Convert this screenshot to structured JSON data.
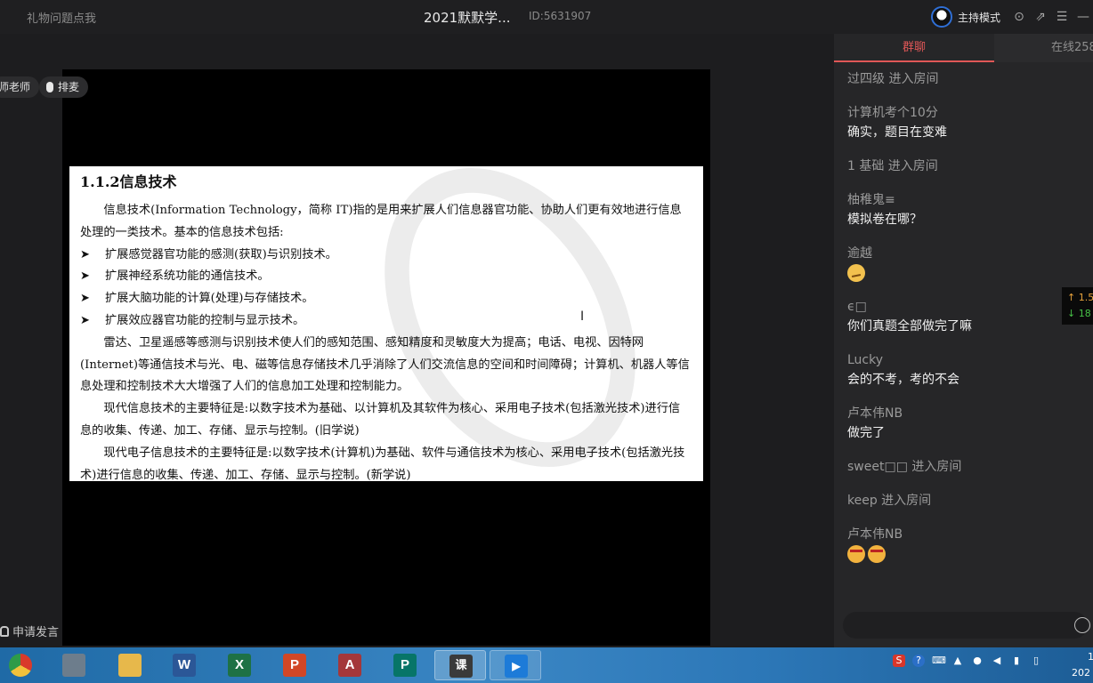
{
  "topbar": {
    "gift_link": "礼物问题点我",
    "room_title": "2021默默学...",
    "room_id": "ID:5631907",
    "host_mode": "主持模式",
    "icons": [
      "settings-icon",
      "popout-icon",
      "menu-icon",
      "minimize-icon"
    ]
  },
  "stage": {
    "teacher_label": "师老师",
    "queue_button": "排麦",
    "apply_speak": "申请发言",
    "document": {
      "heading": "1.1.2信息技术",
      "intro": "信息技术(Information Technology，简称 IT)指的是用来扩展人们信息器官功能、协助人们更有效地进行信息处理的一类技术。基本的信息技术包括:",
      "bullets": [
        "扩展感觉器官功能的感测(获取)与识别技术。",
        "扩展神经系统功能的通信技术。",
        "扩展大脑功能的计算(处理)与存储技术。",
        "扩展效应器官功能的控制与显示技术。"
      ],
      "bullet_marker": "➤",
      "para1": "雷达、卫星遥感等感测与识别技术使人们的感知范围、感知精度和灵敏度大为提高；电话、电视、因特网(Internet)等通信技术与光、电、磁等信息存储技术几乎消除了人们交流信息的空间和时间障碍；计算机、机器人等信息处理和控制技术大大增强了人们的信息加工处理和控制能力。",
      "para2": "现代信息技术的主要特征是:以数字技术为基础、以计算机及其软件为核心、采用电子技术(包括激光技术)进行信息的收集、传递、加工、存储、显示与控制。(旧学说)",
      "para3": "现代电子信息技术的主要特征是:以数字技术(计算机)为基础、软件与通信技术为核心、采用电子技术(包括激光技术)进行信息的收集、传递、加工、存储、显示与控制。(新学说)"
    }
  },
  "chat": {
    "tab_group": "群聊",
    "tab_online": "在线258",
    "messages": [
      {
        "name": "过四级 进入房间",
        "text": ""
      },
      {
        "name": "计算机考个10分",
        "text": "确实，题目在变难"
      },
      {
        "name": "1 基础 进入房间",
        "text": ""
      },
      {
        "name": "柚稚鬼≡",
        "text": "模拟卷在哪？"
      },
      {
        "name": "逾越",
        "text": ""
      },
      {
        "name": "ϵ□",
        "text": "你们真题全部做完了嘛"
      },
      {
        "name": "Lucky",
        "text": "会的不考，考的不会"
      },
      {
        "name": "卢本伟NB",
        "text": "做完了"
      },
      {
        "name": "sweet□□ 进入房间",
        "text": ""
      },
      {
        "name": "keep 进入房间",
        "text": ""
      },
      {
        "name": "卢本伟NB",
        "text": ""
      }
    ],
    "speed_up": "↑ 1.5",
    "speed_down": "↓ 18"
  },
  "taskbar": {
    "apps": [
      {
        "name": "chrome-app",
        "glyph": "",
        "color": "#d93a2b"
      },
      {
        "name": "calculator-app",
        "glyph": "",
        "color": "#6d7d8c"
      },
      {
        "name": "file-explorer-app",
        "glyph": "",
        "color": "#e7b84b"
      },
      {
        "name": "word-app",
        "glyph": "W",
        "color": "#2b5797"
      },
      {
        "name": "excel-app",
        "glyph": "X",
        "color": "#1e7145"
      },
      {
        "name": "powerpoint-app",
        "glyph": "P",
        "color": "#d24726"
      },
      {
        "name": "access-app",
        "glyph": "A",
        "color": "#a4373a"
      },
      {
        "name": "publisher-app",
        "glyph": "P",
        "color": "#077568"
      },
      {
        "name": "ke-app",
        "glyph": "课",
        "color": "#3a3a3a"
      },
      {
        "name": "meeting-app",
        "glyph": "▶",
        "color": "#1d7bd8"
      }
    ],
    "clock_time": "1",
    "clock_date": "202"
  }
}
